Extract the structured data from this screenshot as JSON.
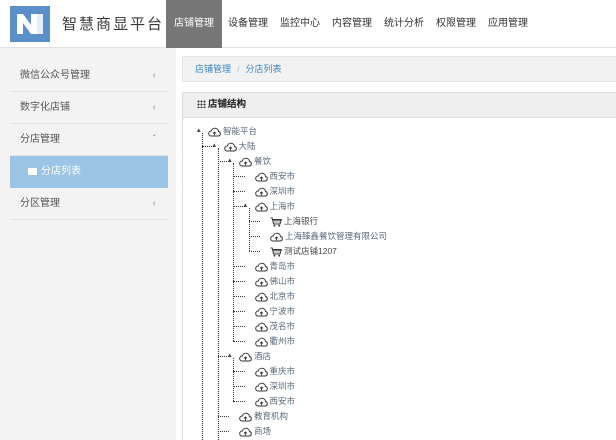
{
  "app": {
    "brand": "智慧商显平台",
    "nav": [
      {
        "label": "店铺管理",
        "active": true
      },
      {
        "label": "设备管理"
      },
      {
        "label": "监控中心"
      },
      {
        "label": "内容管理"
      },
      {
        "label": "统计分析"
      },
      {
        "label": "权限管理"
      },
      {
        "label": "应用管理"
      }
    ]
  },
  "sidebar": {
    "items": [
      {
        "label": "微信公众号管理",
        "chevron": "‹"
      },
      {
        "label": "数字化店铺",
        "chevron": "‹"
      },
      {
        "label": "分店管理",
        "chevron": "ˇ"
      },
      {
        "label": "分店列表"
      },
      {
        "label": "分区管理",
        "chevron": "‹"
      }
    ]
  },
  "breadcrumb": [
    "店铺管理",
    "分店列表"
  ],
  "panel": {
    "title": "店铺结构"
  },
  "tree": [
    {
      "label": "智能平台",
      "icon": "cloud-icon"
    },
    {
      "label": "大陆",
      "icon": "cloud-icon"
    },
    {
      "label": "餐饮",
      "icon": "cloud-icon"
    },
    {
      "label": "西安市",
      "icon": "cloud-icon"
    },
    {
      "label": "深圳市",
      "icon": "cloud-icon"
    },
    {
      "label": "上海市",
      "icon": "cloud-icon"
    },
    {
      "label": "上海银行",
      "icon": "cart-icon"
    },
    {
      "label": "上海臻鑫餐饮管理有限公司",
      "icon": "cloud-icon"
    },
    {
      "label": "测试店铺1207",
      "icon": "cart-icon"
    },
    {
      "label": "青岛市",
      "icon": "cloud-icon"
    },
    {
      "label": "佛山市",
      "icon": "cloud-icon"
    },
    {
      "label": "北京市",
      "icon": "cloud-icon"
    },
    {
      "label": "宁波市",
      "icon": "cloud-icon"
    },
    {
      "label": "茂名市",
      "icon": "cloud-icon"
    },
    {
      "label": "衢州市",
      "icon": "cloud-icon"
    },
    {
      "label": "酒店",
      "icon": "cloud-icon"
    },
    {
      "label": "重庆市",
      "icon": "cloud-icon"
    },
    {
      "label": "深圳市",
      "icon": "cloud-icon"
    },
    {
      "label": "西安市",
      "icon": "cloud-icon"
    },
    {
      "label": "教育机构",
      "icon": "cloud-icon"
    },
    {
      "label": "商场",
      "icon": "cloud-icon"
    }
  ],
  "colors": {
    "accent": "#3a86c5",
    "nav_active": "#777777",
    "sidebar_active": "#9cc4e4"
  }
}
